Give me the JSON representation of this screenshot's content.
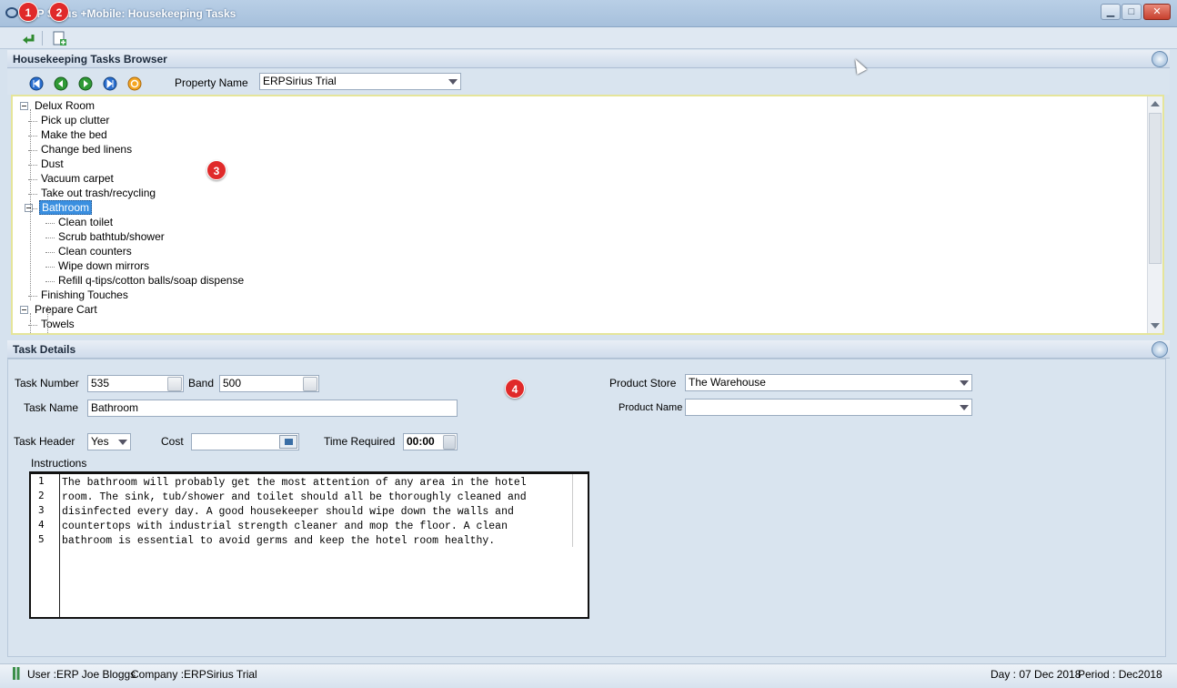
{
  "window": {
    "title": "ERP Sirius +Mobile: Housekeeping Tasks",
    "minimize_label": "▁",
    "maximize_label": "□",
    "close_label": "✕"
  },
  "badges": [
    "1",
    "2",
    "3",
    "4"
  ],
  "toolbar": {
    "icons": [
      "back-arrow-icon",
      "new-document-icon"
    ]
  },
  "browser": {
    "title": "Housekeeping Tasks Browser",
    "nav_icons": [
      "first-record-icon",
      "previous-record-icon",
      "next-record-icon",
      "last-record-icon",
      "refresh-icon"
    ],
    "property_label": "Property Name",
    "property_value": "ERPSirius Trial",
    "tree": [
      {
        "label": "Delux Room",
        "level": 0,
        "expander": true
      },
      {
        "label": "Pick up clutter",
        "level": 1
      },
      {
        "label": "Make the bed",
        "level": 1
      },
      {
        "label": "Change bed linens",
        "level": 1
      },
      {
        "label": "Dust",
        "level": 1
      },
      {
        "label": "Vacuum carpet",
        "level": 1
      },
      {
        "label": "Take out trash/recycling",
        "level": 1
      },
      {
        "label": "Bathroom",
        "level": 1,
        "expander": true,
        "selected": true
      },
      {
        "label": "Clean toilet",
        "level": 2
      },
      {
        "label": "Scrub bathtub/shower",
        "level": 2
      },
      {
        "label": "Clean counters",
        "level": 2
      },
      {
        "label": "Wipe down mirrors",
        "level": 2
      },
      {
        "label": "Refill q-tips/cotton balls/soap dispense",
        "level": 2
      },
      {
        "label": "Finishing Touches",
        "level": 1
      },
      {
        "label": "Prepare Cart",
        "level": 0,
        "expander": true
      },
      {
        "label": "Towels",
        "level": 1
      }
    ]
  },
  "details": {
    "title": "Task Details",
    "task_number_label": "Task Number",
    "task_number": "535",
    "band_label": "Band",
    "band": "500",
    "task_name_label": "Task Name",
    "task_name": "Bathroom",
    "task_header_label": "Task Header",
    "task_header": "Yes",
    "cost_label": "Cost",
    "cost": "",
    "time_required_label": "Time Required",
    "time_required": "00:00",
    "product_store_label": "Product Store",
    "product_store": "The Warehouse",
    "product_name_label": "Product Name",
    "product_name": "",
    "instructions_label": "Instructions",
    "instructions_lines": [
      "The bathroom will probably get the most attention of any area in the hotel",
      "room. The sink, tub/shower and toilet should all be thoroughly cleaned and",
      "disinfected every day. A good housekeeper should wipe down the walls and",
      "countertops with industrial strength cleaner and mop the floor. A clean",
      "bathroom is essential to avoid germs and keep the hotel room healthy."
    ],
    "line_numbers": [
      "1",
      "2",
      "3",
      "4",
      "5"
    ]
  },
  "status": {
    "user": "User :ERP Joe Bloggs",
    "company": "Company :ERPSirius Trial",
    "day": "Day : 07 Dec 2018",
    "period": "Period : Dec2018"
  },
  "colors": {
    "selection": "#3a8fe0",
    "badge": "#e02a2a",
    "tree_border": "#e5e59a"
  }
}
